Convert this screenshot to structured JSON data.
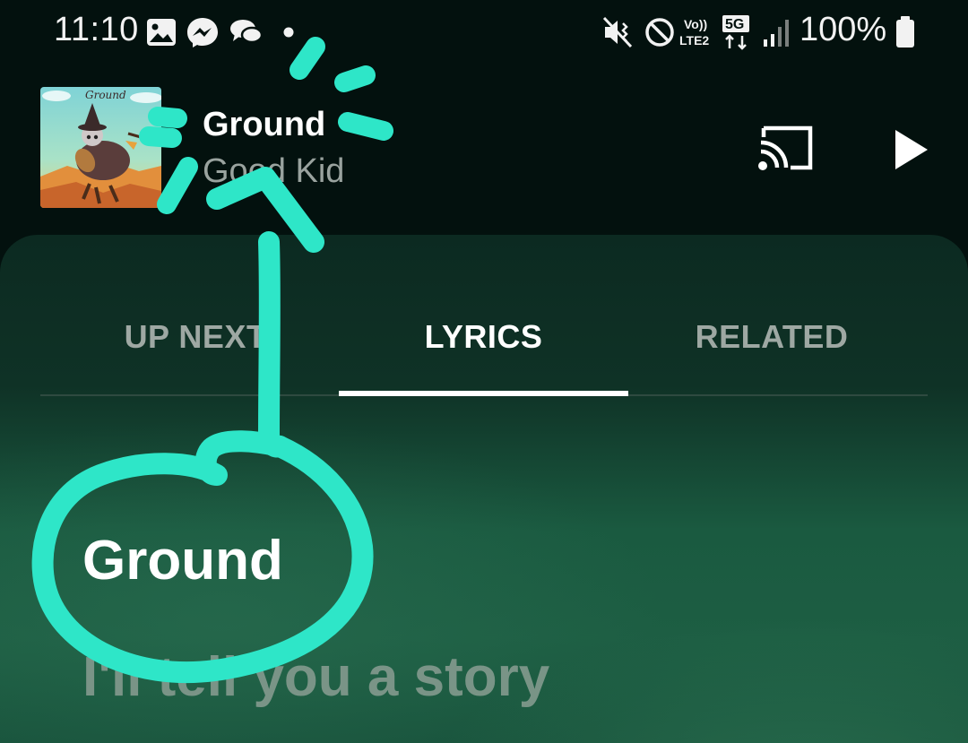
{
  "status_bar": {
    "time": "11:10",
    "battery_percent": "100%",
    "network_label": "5G",
    "volte_label": "Vo)) LTE2",
    "icons": [
      "gallery-icon",
      "messenger-icon",
      "chat-bubbles-icon",
      "notification-dot-icon",
      "mute-vibrate-icon",
      "do-not-disturb-icon",
      "volte-icon",
      "5g-data-icon",
      "signal-bars-icon",
      "battery-icon"
    ]
  },
  "now_playing": {
    "title": "Ground",
    "artist": "Good Kid",
    "album_art_text": "Ground",
    "icons": [
      "cast-icon",
      "play-icon"
    ]
  },
  "tabs": [
    {
      "label": "UP NEXT",
      "selected": false
    },
    {
      "label": "LYRICS",
      "selected": true
    },
    {
      "label": "RELATED",
      "selected": false
    }
  ],
  "lyrics": {
    "title": "Ground",
    "lines": [
      "I'll tell you a story"
    ]
  },
  "colors": {
    "background": "#03110e",
    "sheet_green": "#1d5e43",
    "annotation": "#2ee6c8",
    "active_tab": "#ffffff",
    "inactive_tab": "#9ea8a3"
  }
}
